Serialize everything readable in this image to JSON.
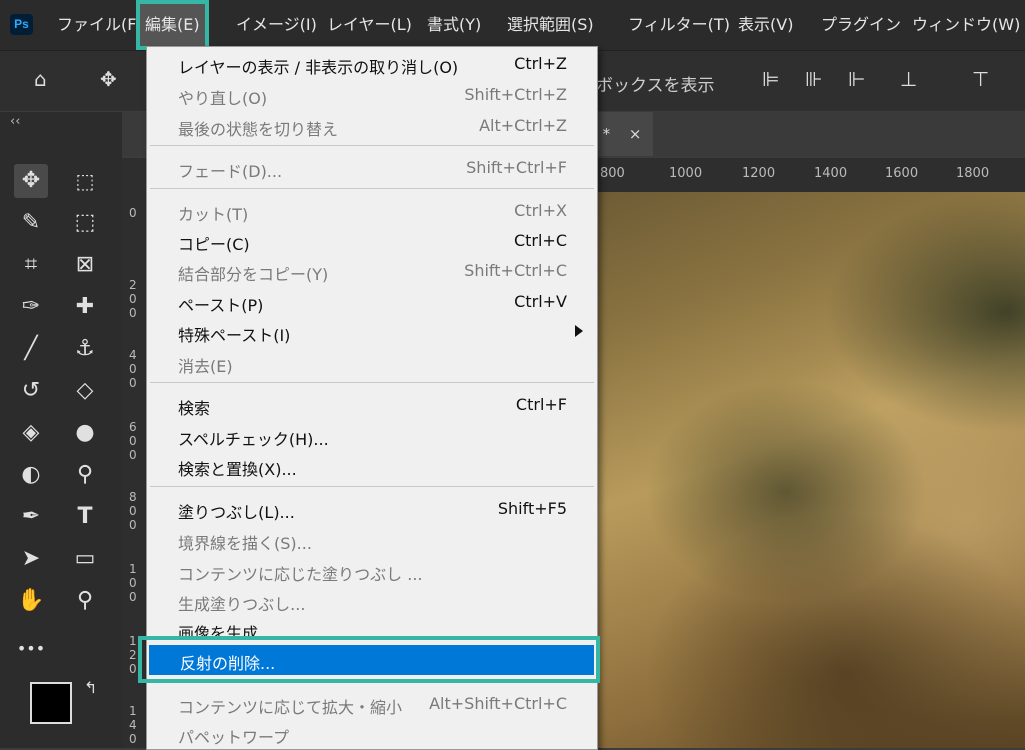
{
  "app": {
    "logo": "Ps"
  },
  "menubar": {
    "items": [
      "ファイル(F)",
      "編集(E)",
      "イメージ(I)",
      "レイヤー(L)",
      "書式(Y)",
      "選択範囲(S)",
      "フィルター(T)",
      "表示(V)",
      "プラグイン",
      "ウィンドウ(W)"
    ],
    "active": "編集(E)"
  },
  "options_bar": {
    "partial_label": "ボックスを表示"
  },
  "document_tab": {
    "partial_title": ") *",
    "close": "×"
  },
  "ruler": {
    "ticks": [
      "800",
      "1000",
      "1200",
      "1400",
      "1600",
      "1800"
    ]
  },
  "vruler": {
    "ticks": [
      "0",
      "2\n0\n0",
      "4\n0\n0",
      "6\n0\n0",
      "8\n0\n0",
      "1\n0\n0",
      "1\n2\n0",
      "1\n4\n0"
    ]
  },
  "edit_menu": {
    "items": [
      {
        "label": "レイヤーの表示 / 非表示の取り消し(O)",
        "shortcut": "Ctrl+Z",
        "enabled": true
      },
      {
        "label": "やり直し(O)",
        "shortcut": "Shift+Ctrl+Z",
        "enabled": false
      },
      {
        "label": "最後の状態を切り替え",
        "shortcut": "Alt+Ctrl+Z",
        "enabled": false
      },
      {
        "label": "フェード(D)...",
        "shortcut": "Shift+Ctrl+F",
        "enabled": false
      },
      {
        "label": "カット(T)",
        "shortcut": "Ctrl+X",
        "enabled": false
      },
      {
        "label": "コピー(C)",
        "shortcut": "Ctrl+C",
        "enabled": true
      },
      {
        "label": "結合部分をコピー(Y)",
        "shortcut": "Shift+Ctrl+C",
        "enabled": false
      },
      {
        "label": "ペースト(P)",
        "shortcut": "Ctrl+V",
        "enabled": true
      },
      {
        "label": "特殊ペースト(I)",
        "shortcut": "",
        "enabled": true,
        "submenu": true
      },
      {
        "label": "消去(E)",
        "shortcut": "",
        "enabled": false
      },
      {
        "label": "検索",
        "shortcut": "Ctrl+F",
        "enabled": true
      },
      {
        "label": "スペルチェック(H)...",
        "shortcut": "",
        "enabled": true
      },
      {
        "label": "検索と置換(X)...",
        "shortcut": "",
        "enabled": true
      },
      {
        "label": "塗りつぶし(L)...",
        "shortcut": "Shift+F5",
        "enabled": true
      },
      {
        "label": "境界線を描く(S)...",
        "shortcut": "",
        "enabled": false
      },
      {
        "label": "コンテンツに応じた塗りつぶし ...",
        "shortcut": "",
        "enabled": false
      },
      {
        "label": "生成塗りつぶし...",
        "shortcut": "",
        "enabled": false
      },
      {
        "label": "画像を生成",
        "shortcut": "",
        "enabled": true
      },
      {
        "label": "反射の削除...",
        "shortcut": "",
        "enabled": true,
        "highlighted": true
      },
      {
        "label": "コンテンツに応じて拡大・縮小",
        "shortcut": "Alt+Shift+Ctrl+C",
        "enabled": false
      },
      {
        "label": "パペットワープ",
        "shortcut": "",
        "enabled": false
      }
    ]
  },
  "colors": {
    "accent_frame": "#36b7a6",
    "menu_highlight": "#0078d7",
    "foreground_swatch": "#000000",
    "background_swatch": "#ffffff"
  },
  "tools": [
    "move-icon",
    "marquee-icon",
    "quick-select-icon",
    "object-select-icon",
    "crop-icon",
    "frame-icon",
    "eyedropper-icon",
    "healing-brush-icon",
    "brush-icon",
    "stamp-icon",
    "history-brush-icon",
    "eraser-icon",
    "paint-bucket-icon",
    "blur-icon",
    "dodge-icon",
    "burn-icon",
    "pen-icon",
    "type-icon",
    "path-select-icon",
    "rectangle-icon",
    "hand-icon",
    "zoom-icon",
    "more-icon"
  ],
  "tool_text": {
    "type": "T",
    "more": "•••"
  }
}
